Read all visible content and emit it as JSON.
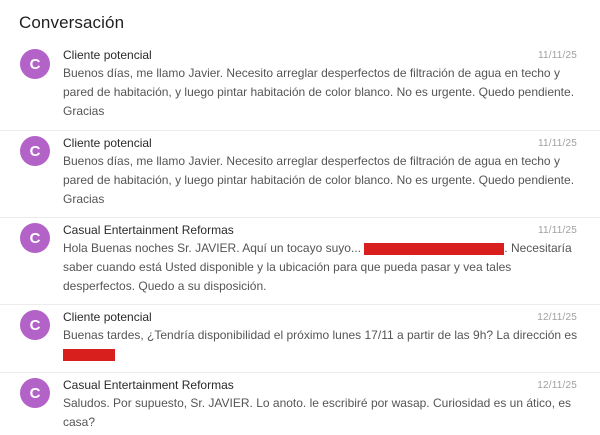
{
  "conversation": {
    "title": "Conversación",
    "messages": [
      {
        "avatar_initial": "C",
        "sender": "Cliente potencial",
        "date": "11/11/25",
        "text": "Buenos días, me llamo Javier. Necesito arreglar desperfectos de filtración de agua en techo y pared de habitación, y luego pintar habitación de color blanco. No es urgente. Quedo pendiente. Gracias"
      },
      {
        "avatar_initial": "C",
        "sender": "Cliente potencial",
        "date": "11/11/25",
        "text": "Buenos días, me llamo Javier. Necesito arreglar desperfectos de filtración de agua en techo y pared de habitación, y luego pintar habitación de color blanco. No es urgente. Quedo pendiente. Gracias"
      },
      {
        "avatar_initial": "C",
        "sender": "Casual Entertainment Reformas",
        "date": "11/11/25",
        "text_before": "Hola Buenas noches Sr. JAVIER. Aquí un tocayo suyo... ",
        "text_after": ". Necesitaría saber cuando está Usted disponible y la ubicación para que pueda pasar y vea tales desperfectos. Quedo a su disposición."
      },
      {
        "avatar_initial": "C",
        "sender": "Cliente potencial",
        "date": "12/11/25",
        "text_before": "Buenas tardes, ¿Tendría disponibilidad el próximo lunes 17/11 a partir de las 9h? La dirección es "
      },
      {
        "avatar_initial": "C",
        "sender": "Casual Entertainment Reformas",
        "date": "12/11/25",
        "text": "Saludos. Por supuesto, Sr. JAVIER. Lo anoto. le escribiré por wasap. Curiosidad es un ático, es casa?"
      }
    ]
  },
  "colors": {
    "avatar": "#b362c8",
    "redaction": "#d91e1e",
    "timestamp": "#a0a0a0"
  }
}
